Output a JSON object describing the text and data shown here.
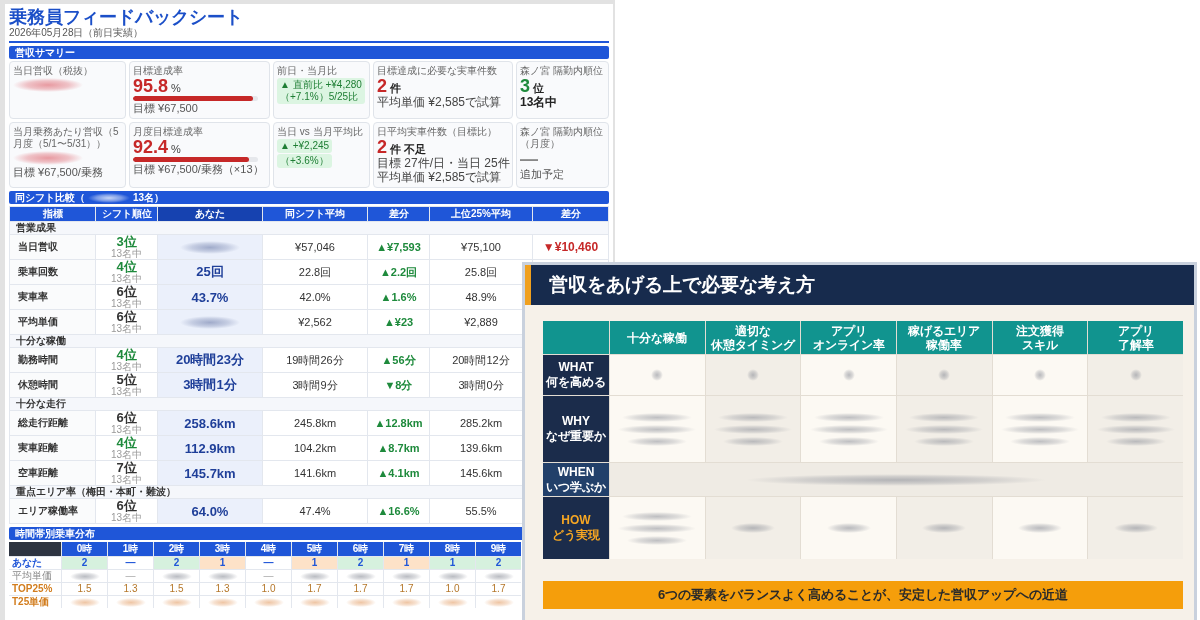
{
  "header": {
    "title": "乗務員フィードバックシート",
    "date": "2026年05月28日（前日実績）"
  },
  "summary": {
    "title": "営収サマリー",
    "cards": [
      {
        "kind": "amount",
        "label": "当日営収（税抜）",
        "blurred": true
      },
      {
        "kind": "rate",
        "label": "目標達成率",
        "value": "95.8",
        "unit": "%",
        "level": 0.958,
        "notes": [
          "目標 ¥67,500"
        ]
      },
      {
        "kind": "change",
        "label": "前日・当月比",
        "badges": [
          {
            "lines": [
              "▲ 直前比 +¥4,280",
              "（+7.1%）5/25比"
            ]
          }
        ]
      },
      {
        "kind": "count",
        "label": "目標達成に必要な実車件数",
        "value": "2",
        "unit": "件",
        "notes": [
          "平均単価 ¥2,585で試算"
        ]
      },
      {
        "kind": "rank",
        "label": "森ノ宮 隔勤内順位",
        "value": "3",
        "unit": "位",
        "notes": [
          "13名中"
        ]
      },
      {
        "kind": "amount",
        "label": "当月乗務あたり営収（5月度（5/1〜5/31））",
        "blurred": true,
        "notes": [
          "目標 ¥67,500/乗務"
        ]
      },
      {
        "kind": "rate",
        "label": "月度目標達成率",
        "value": "92.4",
        "unit": "%",
        "level": 0.924,
        "notes": [
          "目標 ¥67,500/乗務（×13）"
        ]
      },
      {
        "kind": "change",
        "label": "当日 vs 当月平均比",
        "badges": [
          {
            "lines": [
              "▲ +¥2,245"
            ]
          },
          {
            "lines": [
              "（+3.6%）"
            ]
          }
        ]
      },
      {
        "kind": "count",
        "label": "日平均実車件数（目標比）",
        "value": "2",
        "unit": "件 不足",
        "notes": [
          "目標 27件/日・当日 25件",
          "平均単価 ¥2,585で試算"
        ]
      },
      {
        "kind": "pending",
        "label": "森ノ宮 隔勤内順位（月度）",
        "value": "—",
        "notes": [
          "追加予定"
        ]
      }
    ]
  },
  "comparison": {
    "title_start": "同シフト比較（",
    "title_blurred": true,
    "title_end": "13名）",
    "columns": [
      "指標",
      "シフト順位",
      "あなた",
      "同シフト平均",
      "差分",
      "上位25%平均",
      "差分"
    ],
    "groups": [
      {
        "name": "営業成果",
        "rows": [
          {
            "metric": "当日営収",
            "rank": "3位",
            "rank_good": true,
            "rank_note": "13名中",
            "you": {
              "blurred": true
            },
            "shift_avg": "¥57,046",
            "diff": {
              "text": "▲¥7,593",
              "good": true
            },
            "top_avg": "¥75,100",
            "top_diff": {
              "text": "▼¥10,460",
              "good": false
            }
          },
          {
            "metric": "乗車回数",
            "rank": "4位",
            "rank_good": true,
            "rank_note": "13名中",
            "you": {
              "text": "25回"
            },
            "shift_avg": "22.8回",
            "diff": {
              "text": "▲2.2回",
              "good": true
            },
            "top_avg": "25.8回"
          },
          {
            "metric": "実車率",
            "rank": "6位",
            "rank_good": false,
            "rank_note": "13名中",
            "you": {
              "text": "43.7%"
            },
            "shift_avg": "42.0%",
            "diff": {
              "text": "▲1.6%",
              "good": true
            },
            "top_avg": "48.9%"
          },
          {
            "metric": "平均単価",
            "rank": "6位",
            "rank_good": false,
            "rank_note": "13名中",
            "you": {
              "blurred": true
            },
            "shift_avg": "¥2,562",
            "diff": {
              "text": "▲¥23",
              "good": true
            },
            "top_avg": "¥2,889"
          }
        ]
      },
      {
        "name": "十分な稼働",
        "rows": [
          {
            "metric": "勤務時間",
            "rank": "4位",
            "rank_good": true,
            "rank_note": "13名中",
            "you": {
              "text": "20時間23分"
            },
            "shift_avg": "19時間26分",
            "diff": {
              "text": "▲56分",
              "good": true
            },
            "top_avg": "20時間12分"
          },
          {
            "metric": "休憩時間",
            "rank": "5位",
            "rank_good": false,
            "rank_note": "13名中",
            "you": {
              "text": "3時間1分"
            },
            "shift_avg": "3時間9分",
            "diff": {
              "text": "▼8分",
              "good": true
            },
            "top_avg": "3時間0分"
          }
        ]
      },
      {
        "name": "十分な走行",
        "rows": [
          {
            "metric": "総走行距離",
            "rank": "6位",
            "rank_good": false,
            "rank_note": "13名中",
            "you": {
              "text": "258.6km"
            },
            "shift_avg": "245.8km",
            "diff": {
              "text": "▲12.8km",
              "good": true
            },
            "top_avg": "285.2km"
          },
          {
            "metric": "実車距離",
            "rank": "4位",
            "rank_good": true,
            "rank_note": "13名中",
            "you": {
              "text": "112.9km"
            },
            "shift_avg": "104.2km",
            "diff": {
              "text": "▲8.7km",
              "good": true
            },
            "top_avg": "139.6km"
          },
          {
            "metric": "空車距離",
            "rank": "7位",
            "rank_good": false,
            "rank_note": "13名中",
            "you": {
              "text": "145.7km"
            },
            "shift_avg": "141.6km",
            "diff": {
              "text": "▲4.1km",
              "good": true
            },
            "top_avg": "145.6km"
          }
        ]
      },
      {
        "name": "重点エリア率（梅田・本町・難波）",
        "rows": [
          {
            "metric": "エリア稼働率",
            "rank": "6位",
            "rank_good": false,
            "rank_note": "13名中",
            "you": {
              "text": "64.0%"
            },
            "shift_avg": "47.4%",
            "diff": {
              "text": "▲16.6%",
              "good": true
            },
            "top_avg": "55.5%"
          }
        ]
      }
    ]
  },
  "hourly": {
    "title": "時間帯別乗車分布",
    "hours": [
      "0時",
      "1時",
      "2時",
      "3時",
      "4時",
      "5時",
      "6時",
      "7時",
      "8時",
      "9時"
    ],
    "rows": [
      {
        "kind": "you",
        "label": "あなた",
        "cells": [
          {
            "text": "2",
            "ahead": true
          },
          {
            "text": "—"
          },
          {
            "text": "2",
            "ahead": true
          },
          {
            "text": "1",
            "ahead": false
          },
          {
            "text": "—"
          },
          {
            "text": "1",
            "ahead": false
          },
          {
            "text": "2",
            "ahead": true
          },
          {
            "text": "1",
            "ahead": false
          },
          {
            "text": "1",
            "ahead": true
          },
          {
            "text": "2",
            "ahead": true
          }
        ]
      },
      {
        "kind": "price",
        "label": "平均単価",
        "cells": [
          {
            "blurred": true
          },
          {
            "text": "—"
          },
          {
            "blurred": true
          },
          {
            "blurred": true
          },
          {
            "text": "—"
          },
          {
            "blurred": true
          },
          {
            "blurred": true
          },
          {
            "blurred": true
          },
          {
            "blurred": true
          },
          {
            "blurred": true
          }
        ]
      },
      {
        "kind": "top",
        "label": "TOP25%",
        "cells": [
          {
            "text": "1.5"
          },
          {
            "text": "1.3"
          },
          {
            "text": "1.5"
          },
          {
            "text": "1.3"
          },
          {
            "text": "1.0"
          },
          {
            "text": "1.7"
          },
          {
            "text": "1.7"
          },
          {
            "text": "1.7"
          },
          {
            "text": "1.0"
          },
          {
            "text": "1.7"
          }
        ]
      },
      {
        "kind": "top_price",
        "label": "T25単価",
        "cells": [
          {
            "blurred": true
          },
          {
            "blurred": true
          },
          {
            "blurred": true
          },
          {
            "blurred": true
          },
          {
            "blurred": true
          },
          {
            "blurred": true
          },
          {
            "blurred": true
          },
          {
            "blurred": true
          },
          {
            "blurred": true
          },
          {
            "blurred": true
          }
        ]
      }
    ]
  },
  "slide": {
    "title": "営収をあげる上で必要な考え方",
    "columns": [
      {
        "lines": [
          "十分な稼働"
        ]
      },
      {
        "lines": [
          "適切な",
          "休憩タイミング"
        ]
      },
      {
        "lines": [
          "アプリ",
          "オンライン率"
        ]
      },
      {
        "lines": [
          "稼げるエリア",
          "稼働率"
        ]
      },
      {
        "lines": [
          "注文獲得",
          "スキル"
        ]
      },
      {
        "lines": [
          "アプリ",
          "了解率"
        ]
      }
    ],
    "rows": [
      {
        "kind": "what",
        "heading": [
          "WHAT",
          "何を高める"
        ],
        "cells": [
          {
            "kind": "dot"
          },
          {
            "kind": "dot"
          },
          {
            "kind": "dot"
          },
          {
            "kind": "dot"
          },
          {
            "kind": "dot"
          },
          {
            "kind": "dot"
          }
        ]
      },
      {
        "kind": "why",
        "heading": [
          "WHY",
          "なぜ重要か"
        ],
        "cells": [
          {
            "kind": "lines"
          },
          {
            "kind": "lines"
          },
          {
            "kind": "lines"
          },
          {
            "kind": "lines"
          },
          {
            "kind": "lines"
          },
          {
            "kind": "lines"
          }
        ]
      },
      {
        "kind": "when",
        "heading": [
          "WHEN",
          "いつ学ぶか"
        ],
        "cells": [
          {
            "kind": "wide"
          }
        ]
      },
      {
        "kind": "how",
        "heading": [
          "HOW",
          "どう実現"
        ],
        "cells": [
          {
            "kind": "lines"
          },
          {
            "kind": "line"
          },
          {
            "kind": "line"
          },
          {
            "kind": "line"
          },
          {
            "kind": "line"
          },
          {
            "kind": "line"
          }
        ]
      }
    ],
    "banner": "6つの要素をバランスよく高めることが、安定した営収アップへの近道"
  }
}
